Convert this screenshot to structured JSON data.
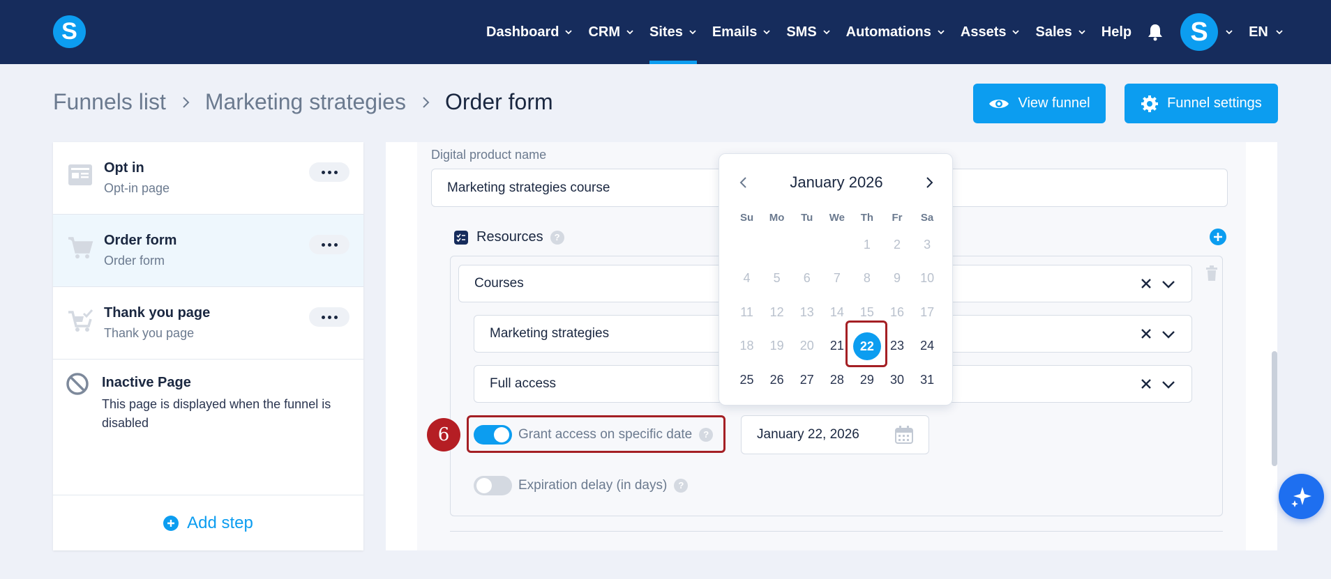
{
  "app": {
    "logo_letter": "S",
    "avatar_letter": "S",
    "language": "EN",
    "brand_color": "#0c9df0",
    "nav_bg": "#162c5c",
    "highlight_color": "#a41f24"
  },
  "nav": {
    "items": [
      {
        "label": "Dashboard"
      },
      {
        "label": "CRM"
      },
      {
        "label": "Sites",
        "active": true
      },
      {
        "label": "Emails"
      },
      {
        "label": "SMS"
      },
      {
        "label": "Automations"
      },
      {
        "label": "Assets"
      },
      {
        "label": "Sales"
      }
    ],
    "help": "Help"
  },
  "breadcrumb": {
    "funnels": "Funnels list",
    "funnel": "Marketing strategies",
    "current": "Order form"
  },
  "buttons": {
    "view_funnel": "View funnel",
    "funnel_settings": "Funnel settings"
  },
  "steps": [
    {
      "title": "Opt in",
      "subtitle": "Opt-in page",
      "icon": "optin-page-icon"
    },
    {
      "title": "Order form",
      "subtitle": "Order form",
      "icon": "cart-icon",
      "selected": true
    },
    {
      "title": "Thank you page",
      "subtitle": "Thank you page",
      "icon": "cart-check-icon"
    }
  ],
  "inactive_page": {
    "title": "Inactive Page",
    "description": "This page is displayed when the funnel is disabled"
  },
  "add_step": "Add step",
  "form": {
    "digital_product_label": "Digital product name",
    "digital_product_value": "Marketing strategies course",
    "resources_label": "Resources",
    "resource_type": "Courses",
    "course": "Marketing strategies",
    "access": "Full access",
    "grant_access_label": "Grant access on specific date",
    "grant_access_on": true,
    "grant_date": "January 22, 2026",
    "expiration_label": "Expiration delay (in days)",
    "expiration_on": false
  },
  "calendar": {
    "month_label": "January 2026",
    "weekdays": [
      "Su",
      "Mo",
      "Tu",
      "We",
      "Th",
      "Fr",
      "Sa"
    ],
    "weeks": [
      [
        "",
        "",
        "",
        "",
        "1",
        "2",
        "3"
      ],
      [
        "4",
        "5",
        "6",
        "7",
        "8",
        "9",
        "10"
      ],
      [
        "11",
        "12",
        "13",
        "14",
        "15",
        "16",
        "17"
      ],
      [
        "18",
        "19",
        "20",
        "21",
        "22",
        "23",
        "24"
      ],
      [
        "25",
        "26",
        "27",
        "28",
        "29",
        "30",
        "31"
      ]
    ],
    "selected_day": "22",
    "first_enabled_day": 21
  },
  "annotation": {
    "step_number": "6"
  }
}
